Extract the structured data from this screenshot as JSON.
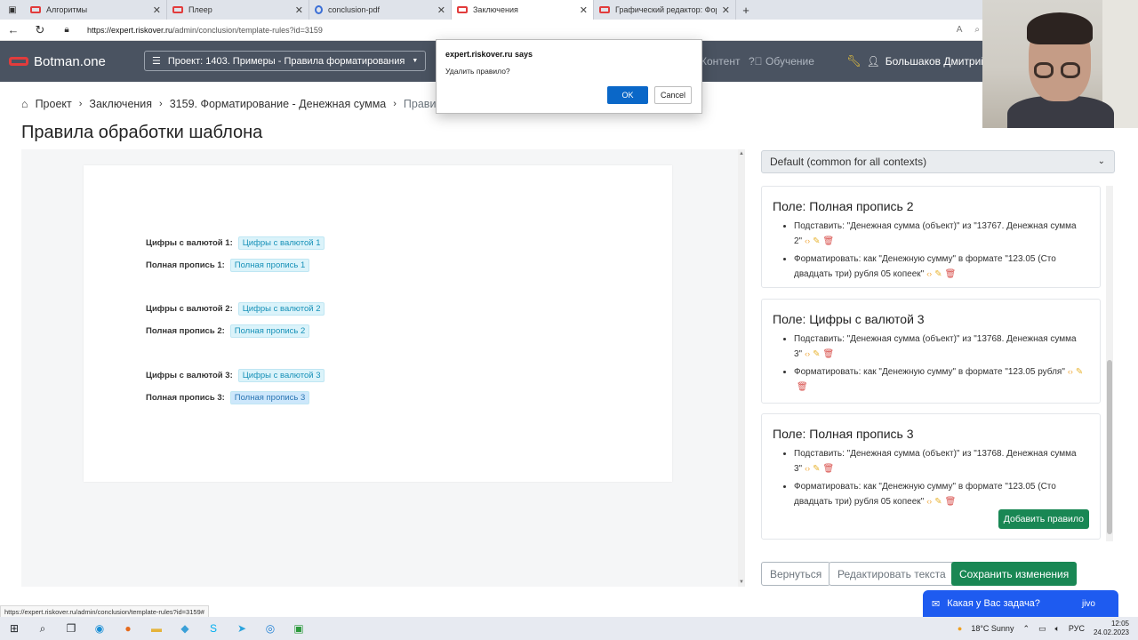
{
  "browser": {
    "tabs": [
      {
        "title": "Алгоритмы"
      },
      {
        "title": "Плеер"
      },
      {
        "title": "conclusion-pdf"
      },
      {
        "title": "Заключения"
      },
      {
        "title": "Графический редактор: Формат"
      }
    ],
    "url_host": "https://expert.riskover.ru",
    "url_path": "/admin/conclusion/template-rules?id=3159",
    "new_tab": "+"
  },
  "navbar": {
    "brand": "Botman.one",
    "project_dropdown": "Проект: 1403. Примеры - Правила форматирования",
    "links": {
      "content": "Контент",
      "learning": "Обучение"
    },
    "user": "Большаков Дмитрий"
  },
  "dialog": {
    "origin": "expert.riskover.ru says",
    "message": "Удалить правило?",
    "ok": "OK",
    "cancel": "Cancel"
  },
  "breadcrumb": [
    "Проект",
    "Заключения",
    "3159. Форматирование - Денежная сумма",
    "Правила об"
  ],
  "page_title": "Правила обработки шаблона",
  "preview": {
    "rows": [
      {
        "label": "Цифры с валютой 1:",
        "chip": "Цифры с валютой 1"
      },
      {
        "label": "Полная пропись 1:",
        "chip": "Полная пропись 1"
      },
      {
        "label": "Цифры с валютой 2:",
        "chip": "Цифры с валютой 2"
      },
      {
        "label": "Полная пропись 2:",
        "chip": "Полная пропись 2"
      },
      {
        "label": "Цифры с валютой 3:",
        "chip": "Цифры с валютой 3"
      },
      {
        "label": "Полная пропись 3:",
        "chip": "Полная пропись 3"
      }
    ]
  },
  "context_select": "Default (common for all contexts)",
  "rules": [
    {
      "title": "Поле: Полная пропись 2",
      "items": [
        "Подставить: \"Денежная сумма (объект)\" из \"13767. Денежная сумма 2\"",
        "Форматировать: как \"Денежную сумму\" в формате \"123.05 (Сто двадцать три) рубля 05 копеек\""
      ]
    },
    {
      "title": "Поле: Цифры с валютой 3",
      "items": [
        "Подставить: \"Денежная сумма (объект)\" из \"13768. Денежная сумма 3\"",
        "Форматировать: как \"Денежную сумму\" в формате \"123.05 рубля\""
      ]
    },
    {
      "title": "Поле: Полная пропись 3",
      "items": [
        "Подставить: \"Денежная сумма (объект)\" из \"13768. Денежная сумма 3\"",
        "Форматировать: как \"Денежную сумму\" в формате \"123.05 (Сто двадцать три) рубля 05 копеек\""
      ]
    }
  ],
  "add_rule_button": "Добавить правило",
  "buttons": {
    "back": "Вернуться",
    "edit_text": "Редактировать текста",
    "save": "Сохранить изменения"
  },
  "jivo": {
    "prompt": "Какая у Вас задача?",
    "logo": "jivo"
  },
  "status_url": "https://expert.riskover.ru/admin/conclusion/template-rules?id=3159#",
  "taskbar": {
    "weather": "18°C  Sunny",
    "lang": "РУС",
    "time": "12:05",
    "date": "24.02.2023"
  }
}
